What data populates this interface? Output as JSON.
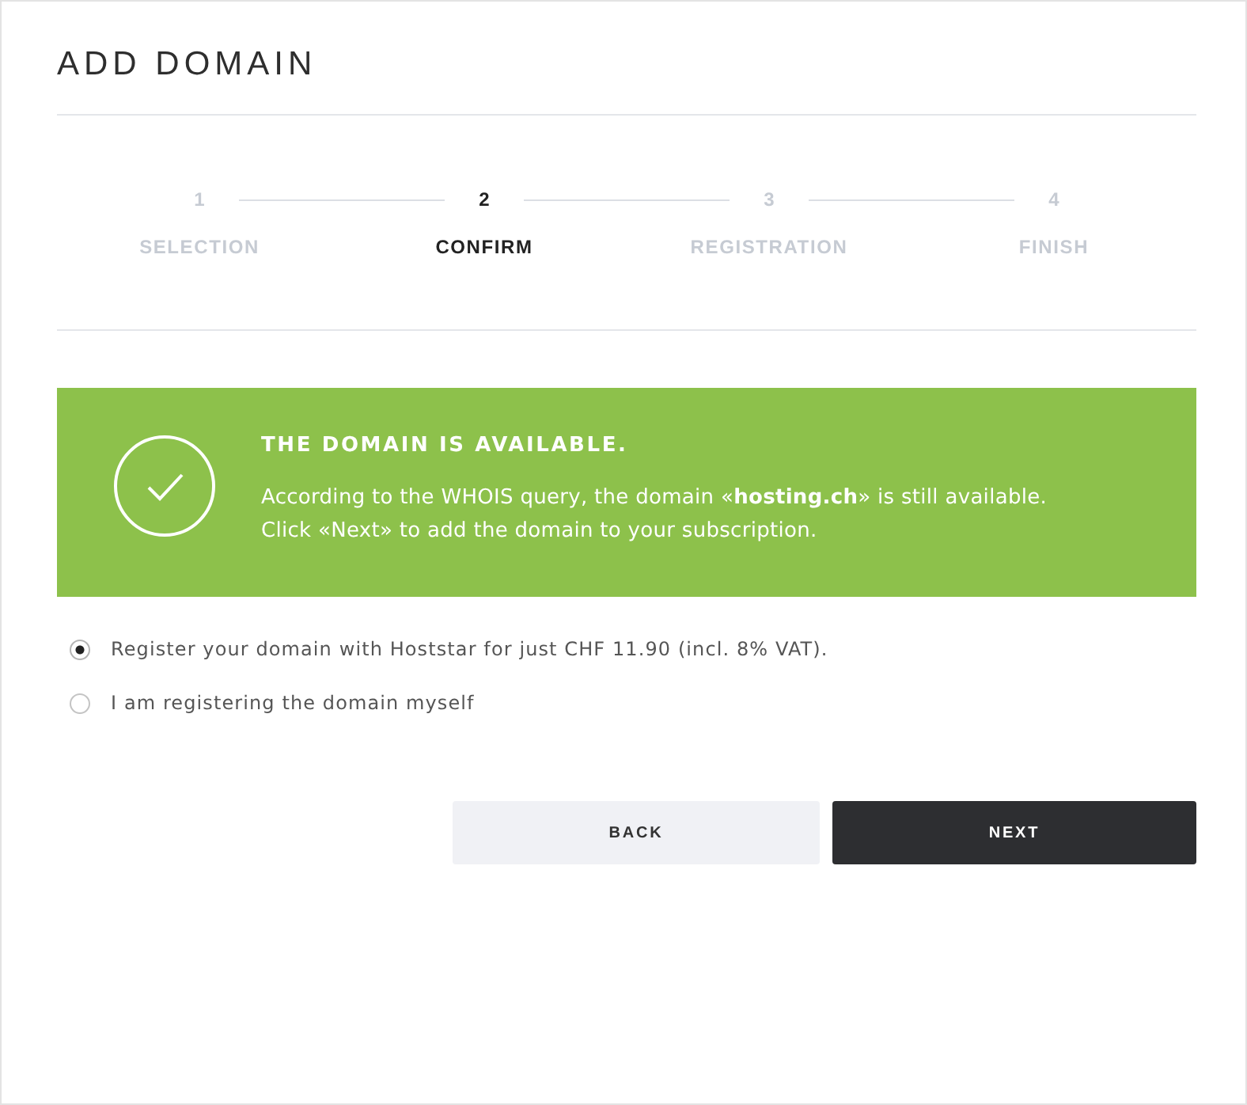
{
  "header": {
    "title": "ADD DOMAIN"
  },
  "steps": [
    {
      "number": "1",
      "label": "SELECTION",
      "selected": false
    },
    {
      "number": "2",
      "label": "CONFIRM",
      "selected": true
    },
    {
      "number": "3",
      "label": "REGISTRATION",
      "selected": false
    },
    {
      "number": "4",
      "label": "FINISH",
      "selected": false
    }
  ],
  "notice": {
    "title": "THE DOMAIN IS AVAILABLE.",
    "lines": [
      "According to the WHOIS query, the domain «**hosting.ch**» is still available.",
      "Click «Next» to add the domain to your subscription."
    ]
  },
  "options": [
    {
      "label": "Register your domain with Hoststar for just CHF 11.90 (incl. 8% VAT).",
      "selected": true
    },
    {
      "label": "I am registering the domain myself",
      "selected": false
    }
  ],
  "buttons": [
    {
      "label": "BACK",
      "kind": "secondary"
    },
    {
      "label": "NEXT",
      "kind": "primary"
    }
  ]
}
